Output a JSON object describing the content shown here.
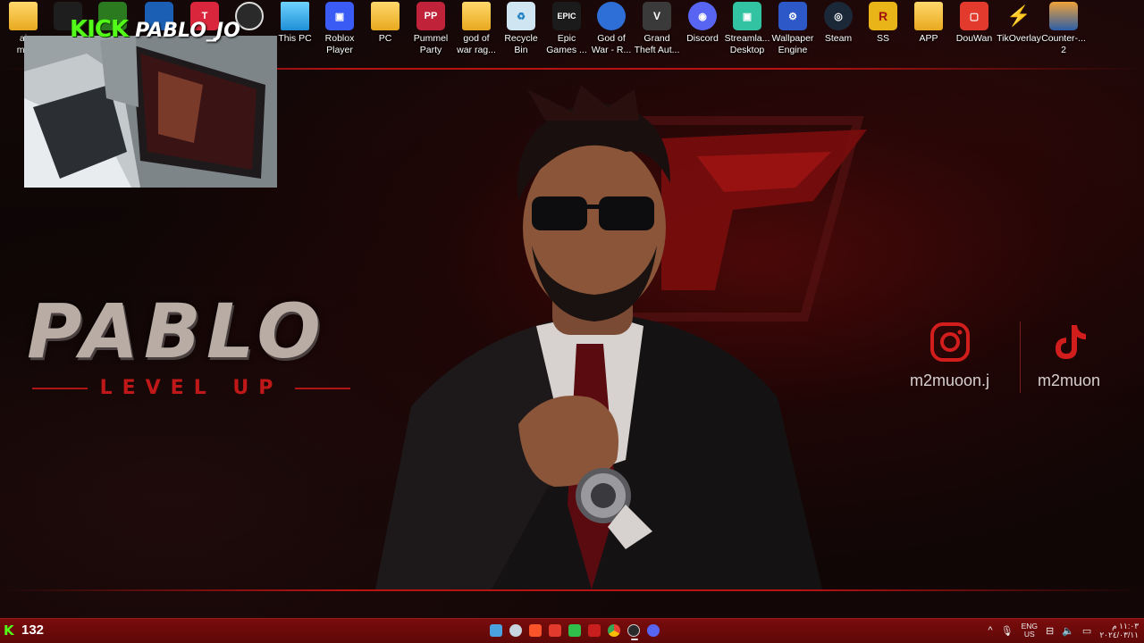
{
  "desktop": {
    "icons": [
      {
        "label": "ai\nmu",
        "type": "folder",
        "color": "#f4c542"
      },
      {
        "label": "",
        "type": "app",
        "color": "#1e1e1e"
      },
      {
        "label": "",
        "type": "app",
        "color": "#2b7a1f"
      },
      {
        "label": "",
        "type": "app",
        "color": "#1a5fb4"
      },
      {
        "label": "",
        "type": "app",
        "color": "#d9263c"
      },
      {
        "label": "",
        "type": "app",
        "color": "#2a2a2a"
      },
      {
        "label": "This PC",
        "type": "monitor",
        "color": "#2fb5e8"
      },
      {
        "label": "Roblox\nPlayer",
        "type": "app",
        "color": "#3b5cf4"
      },
      {
        "label": "PC",
        "type": "folder",
        "color": "#f4c542"
      },
      {
        "label": "Pummel\nParty",
        "type": "app",
        "color": "#c0223a"
      },
      {
        "label": "god of\nwar rag...",
        "type": "folder",
        "color": "#f4c542"
      },
      {
        "label": "Recycle\nBin",
        "type": "bin",
        "color": "#cfe6f2"
      },
      {
        "label": "Epic\nGames ...",
        "type": "app",
        "color": "#1b1b1b"
      },
      {
        "label": "God of\nWar - R...",
        "type": "app",
        "color": "#2d6fd6"
      },
      {
        "label": "Grand\nTheft Aut...",
        "type": "app",
        "color": "#3a3a3a"
      },
      {
        "label": "Discord",
        "type": "app",
        "color": "#5865f2"
      },
      {
        "label": "Streamla...\nDesktop",
        "type": "app",
        "color": "#31c3a2"
      },
      {
        "label": "Wallpaper\nEngine",
        "type": "app",
        "color": "#2c59c7"
      },
      {
        "label": "Steam",
        "type": "app",
        "color": "#1b2838"
      },
      {
        "label": "SS",
        "type": "app",
        "color": "#e8b417"
      },
      {
        "label": "APP",
        "type": "folder",
        "color": "#f4c542"
      },
      {
        "label": "DouWan",
        "type": "app",
        "color": "#e23b2e"
      },
      {
        "label": "TikOverlay",
        "type": "app",
        "color": "#b41a1a"
      },
      {
        "label": "Counter-...\n2",
        "type": "app",
        "color": "#e58a1a"
      }
    ]
  },
  "stream_overlay": {
    "platform": "KICK",
    "username": "PABLO_JO"
  },
  "wallpaper": {
    "title": "PABLO",
    "subtitle": "LEVEL UP",
    "socials": [
      {
        "icon": "instagram-icon",
        "handle": "m2muoon.j"
      },
      {
        "icon": "tiktok-icon",
        "handle": "m2muon"
      }
    ]
  },
  "taskbar": {
    "viewer_count": "132",
    "viewer_icon": "K",
    "apps": [
      {
        "name": "file-explorer",
        "color": "#4aa3df"
      },
      {
        "name": "steam",
        "color": "#c7d5e0"
      },
      {
        "name": "brave",
        "color": "#fb542b"
      },
      {
        "name": "red-app",
        "color": "#e23b2e"
      },
      {
        "name": "lock-app",
        "color": "#2fbf4a"
      },
      {
        "name": "red-app-2",
        "color": "#c81e1e"
      },
      {
        "name": "chrome",
        "color": "#f2c21a"
      },
      {
        "name": "obs",
        "color": "#2a2a2a",
        "active": true
      },
      {
        "name": "discord",
        "color": "#5865f2"
      }
    ],
    "tray": {
      "chevron": "^",
      "lang_line1": "ENG",
      "lang_line2": "US",
      "time_line1": "١١:٠٣ م",
      "time_line2": "٢٠٢٤/٠٣/١١"
    }
  }
}
